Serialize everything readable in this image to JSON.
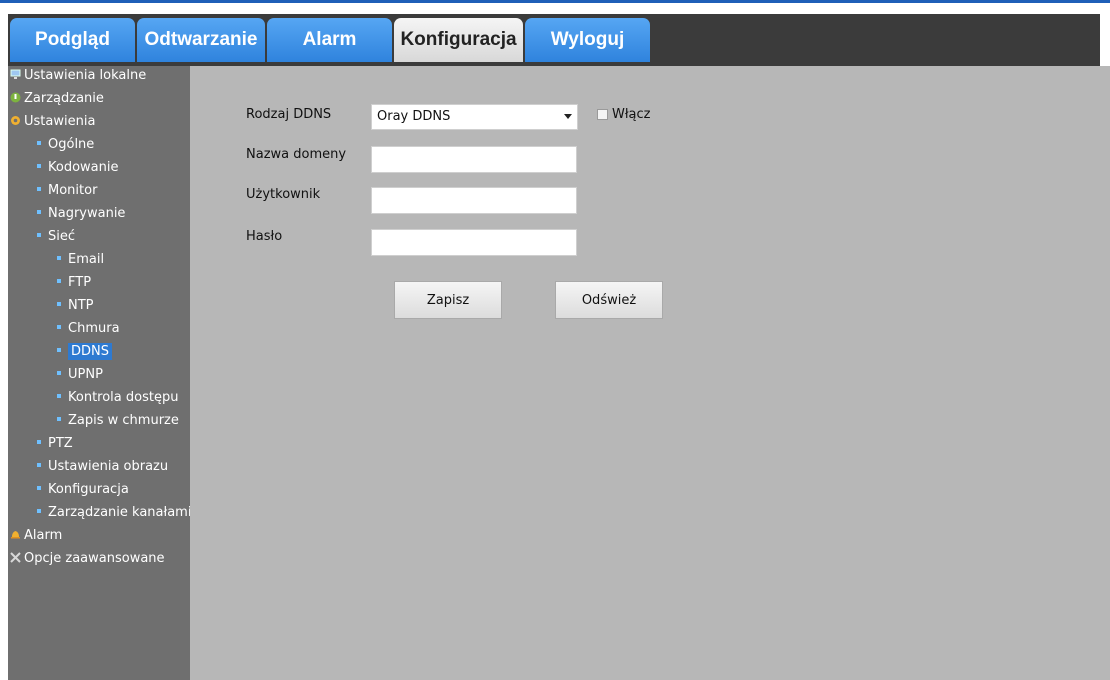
{
  "colors": {
    "accent": "#2f83dd",
    "sidebar_bg": "#6f6f6f",
    "content_bg": "#b7b7b7",
    "header_bg": "#3b3b3b"
  },
  "tabs": [
    {
      "label": "Podgląd"
    },
    {
      "label": "Odtwarzanie"
    },
    {
      "label": "Alarm"
    },
    {
      "label": "Konfiguracja",
      "active": true
    },
    {
      "label": "Wyloguj"
    }
  ],
  "sidebar": {
    "items": [
      {
        "label": "Ustawienia lokalne",
        "icon": "monitor-icon"
      },
      {
        "label": "Zarządzanie",
        "icon": "shield-icon"
      },
      {
        "label": "Ustawienia",
        "icon": "gear-icon"
      },
      {
        "label": "Ogólne"
      },
      {
        "label": "Kodowanie"
      },
      {
        "label": "Monitor"
      },
      {
        "label": "Nagrywanie"
      },
      {
        "label": "Sieć"
      },
      {
        "label": "Email"
      },
      {
        "label": "FTP"
      },
      {
        "label": "NTP"
      },
      {
        "label": "Chmura"
      },
      {
        "label": "DDNS",
        "selected": true
      },
      {
        "label": "UPNP"
      },
      {
        "label": "Kontrola dostępu"
      },
      {
        "label": "Zapis w chmurze"
      },
      {
        "label": "PTZ"
      },
      {
        "label": "Ustawienia obrazu"
      },
      {
        "label": "Konfiguracja"
      },
      {
        "label": "Zarządzanie kanałami"
      },
      {
        "label": "Alarm",
        "icon": "bell-icon"
      },
      {
        "label": "Opcje zaawansowane",
        "icon": "tools-icon"
      }
    ]
  },
  "form": {
    "ddns_type_label": "Rodzaj DDNS",
    "ddns_type_value": "Oray DDNS",
    "enable_label": "Włącz",
    "enable_checked": false,
    "domain_label": "Nazwa domeny",
    "domain_value": "",
    "user_label": "Użytkownik",
    "user_value": "",
    "password_label": "Hasło",
    "password_value": ""
  },
  "buttons": {
    "save": "Zapisz",
    "refresh": "Odśwież"
  }
}
